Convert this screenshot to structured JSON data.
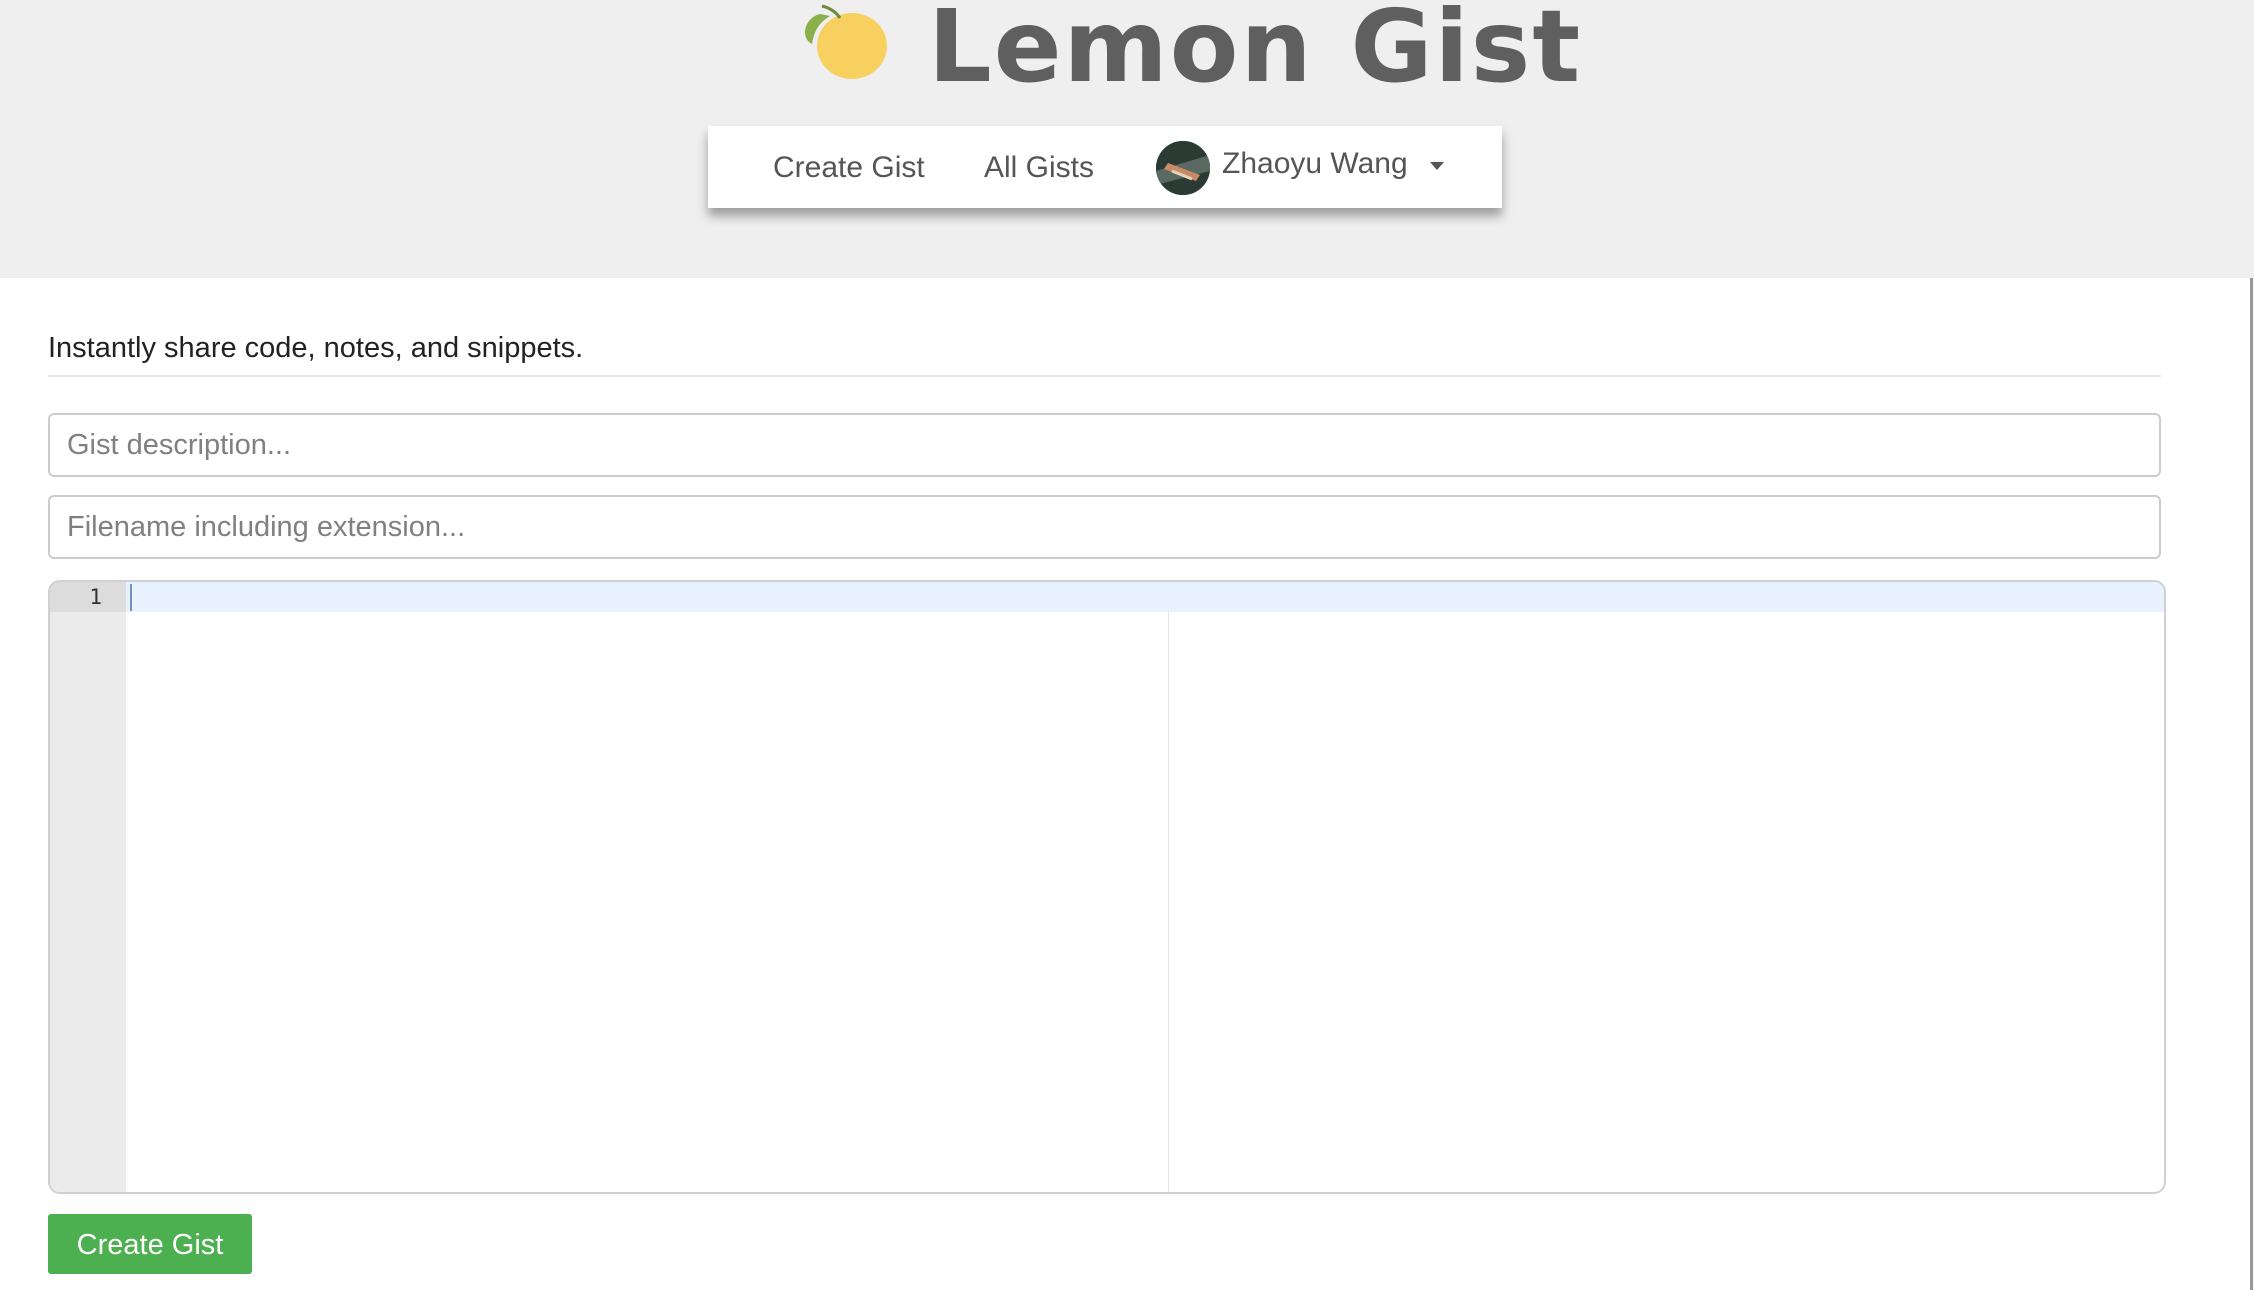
{
  "app": {
    "title": "Lemon Gist",
    "logo_icon": "lemon-icon",
    "colors": {
      "background": "#efefef",
      "lemon": "#f8d060",
      "leaf": "#8ab04c",
      "accent_green": "#4caf50",
      "title_text": "#5f5f5f"
    }
  },
  "nav": {
    "create_label": "Create Gist",
    "all_label": "All Gists",
    "user_name": "Zhaoyu Wang",
    "dropdown_icon": "caret-down-icon"
  },
  "main": {
    "tagline": "Instantly share code, notes, and snippets.",
    "description_placeholder": "Gist description...",
    "description_value": "",
    "filename_placeholder": "Filename including extension...",
    "filename_value": "",
    "editor": {
      "line_numbers": [
        "1"
      ],
      "content": ""
    },
    "submit_label": "Create Gist"
  }
}
